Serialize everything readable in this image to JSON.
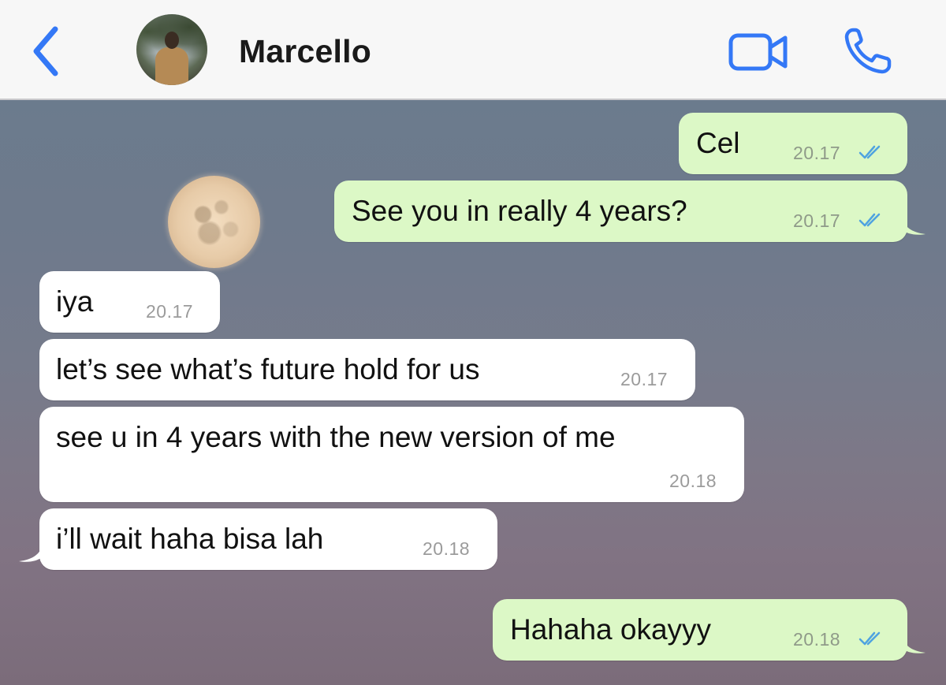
{
  "header": {
    "contact_name": "Marcello",
    "back_icon": "chevron-left-icon",
    "video_icon": "video-camera-icon",
    "call_icon": "phone-icon",
    "accent_color": "#3478f6"
  },
  "messages": [
    {
      "direction": "outgoing",
      "text": "Cel",
      "time": "20.17",
      "status": "read"
    },
    {
      "direction": "outgoing",
      "text": "See you in really 4 years?",
      "time": "20.17",
      "status": "read"
    },
    {
      "direction": "incoming",
      "text": "iya",
      "time": "20.17"
    },
    {
      "direction": "incoming",
      "text": "let’s see what’s future hold for us",
      "time": "20.17"
    },
    {
      "direction": "incoming",
      "text": "see u in 4 years with the new version of me",
      "time": "20.18"
    },
    {
      "direction": "incoming",
      "text": "i’ll wait haha bisa lah",
      "time": "20.18"
    },
    {
      "direction": "outgoing",
      "text": "Hahaha okayyy",
      "time": "20.18",
      "status": "read"
    }
  ],
  "colors": {
    "outgoing_bubble": "#dcf8c6",
    "incoming_bubble": "#ffffff",
    "read_ticks": "#4fa3e0"
  }
}
